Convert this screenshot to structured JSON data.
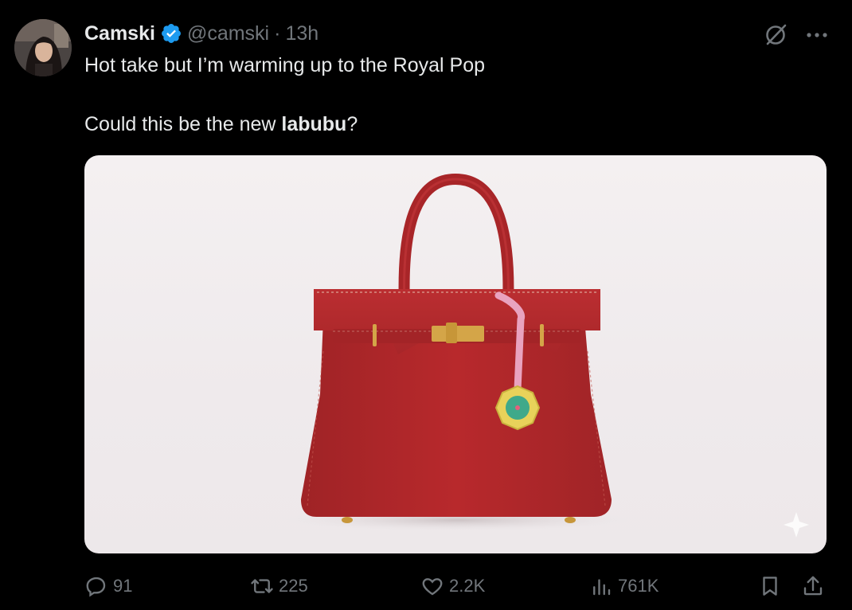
{
  "author": {
    "display_name": "Camski",
    "handle": "@camski",
    "separator": "·",
    "time": "13h",
    "verified": true,
    "verified_color": "#1d9bf0"
  },
  "tweet": {
    "line1": "Hot take but I’m warming up to the Royal Pop",
    "line2_prefix": "Could this be the new ",
    "line2_bold": "labubu",
    "line2_suffix": "?"
  },
  "media": {
    "description_icon": "sparkle-icon",
    "bag_color": "#b5282b"
  },
  "actions": {
    "replies": "91",
    "reposts": "225",
    "likes": "2.2K",
    "views": "761K"
  },
  "icons": [
    "grok-icon",
    "more-icon",
    "reply-icon",
    "repost-icon",
    "like-icon",
    "views-icon",
    "bookmark-icon",
    "share-icon"
  ]
}
